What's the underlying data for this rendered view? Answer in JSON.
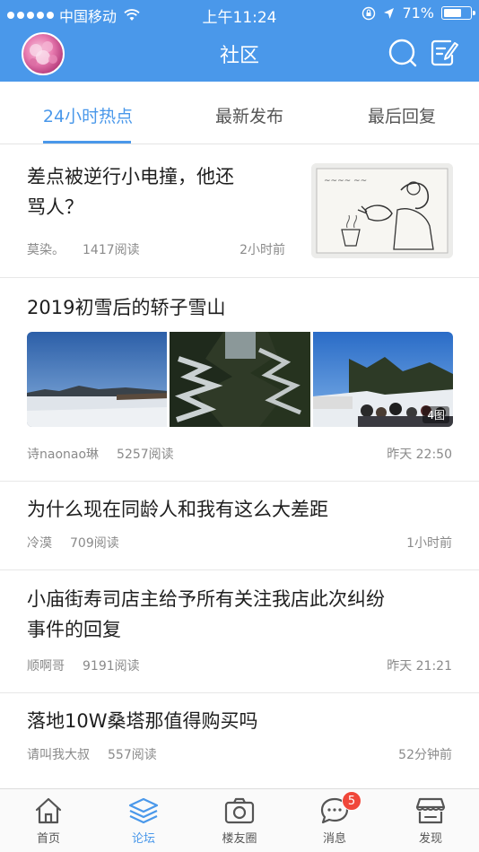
{
  "status_bar": {
    "carrier": "中国移动",
    "time": "上午11:24",
    "battery": "71%",
    "battery_level": 0.71
  },
  "header": {
    "title": "社区",
    "avatar_icon": "user-avatar",
    "search_icon": "search-icon",
    "compose_icon": "compose-icon"
  },
  "tabs": [
    {
      "label": "24小时热点",
      "active": true
    },
    {
      "label": "最新发布",
      "active": false
    },
    {
      "label": "最后回复",
      "active": false
    }
  ],
  "posts": [
    {
      "title_lines": [
        "差点被逆行小电撞，他还",
        "骂人？"
      ],
      "author": "莫染。",
      "reads": "1417阅读",
      "time": "2小时前",
      "thumbnail": "cartoon-sketch"
    },
    {
      "title": "2019初雪后的轿子雪山",
      "author": "诗naonao琳",
      "reads": "5257阅读",
      "time": "昨天 22:50",
      "images": [
        "snow-field",
        "snowy-trees",
        "crowd-in-snow"
      ],
      "image_count": "4图"
    },
    {
      "title": "为什么现在同龄人和我有这么大差距",
      "author": "冷漠",
      "reads": "709阅读",
      "time": "1小时前"
    },
    {
      "title_lines": [
        "小庙街寿司店主给予所有关注我店此次纠纷",
        "事件的回复"
      ],
      "author": "顺啊哥",
      "reads": "9191阅读",
      "time": "昨天 21:21"
    },
    {
      "title": "落地10W桑塔那值得购买吗",
      "author": "请叫我大叔",
      "reads": "557阅读",
      "time": "52分钟前"
    }
  ],
  "bottom_nav": [
    {
      "label": "首页",
      "icon": "home-icon",
      "active": false
    },
    {
      "label": "论坛",
      "icon": "forum-layers-icon",
      "active": true
    },
    {
      "label": "楼友圈",
      "icon": "camera-icon",
      "active": false
    },
    {
      "label": "消息",
      "icon": "message-icon",
      "active": false,
      "badge": "5"
    },
    {
      "label": "发现",
      "icon": "discover-shop-icon",
      "active": false
    }
  ],
  "colors": {
    "brand": "#4a98ea",
    "badge": "#f0473a",
    "text_primary": "#1e1e1e",
    "text_muted": "#8a8a8a"
  }
}
